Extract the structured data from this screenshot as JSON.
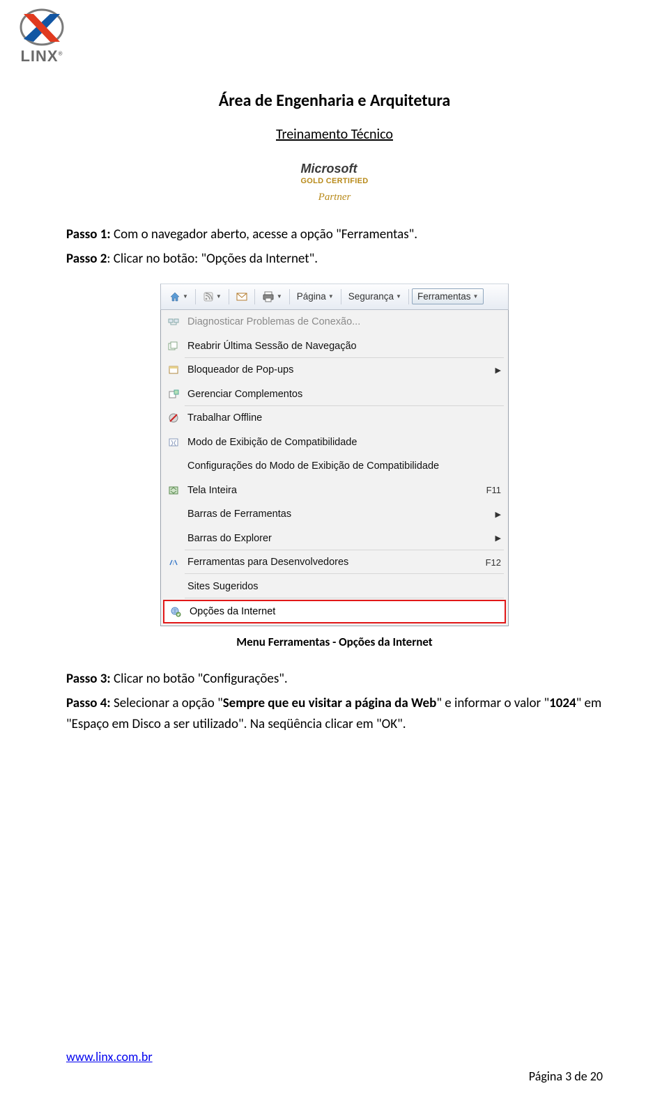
{
  "logo": {
    "text": "LINX",
    "reg": "®"
  },
  "header": {
    "title": "Área de Engenharia e Arquitetura",
    "subtitle": "Treinamento Técnico",
    "badge": {
      "line1": "Microsoft",
      "line2": "GOLD CERTIFIED",
      "line3": "Partner"
    }
  },
  "body": {
    "p1_label": "Passo 1:",
    "p1_text": " Com o navegador aberto, acesse a opção \"Ferramentas\".",
    "p2_label": "Passo 2",
    "p2_text": ": Clicar no botão: \"Opções da Internet\".",
    "caption": "Menu Ferramentas - Opções da Internet",
    "p3_label": "Passo 3:",
    "p3_text": " Clicar no botão \"Configurações\".",
    "p4_label": "Passo 4:",
    "p4_text_a": " Selecionar a opção \"",
    "p4_bold_a": "Sempre que eu visitar a página da Web",
    "p4_text_b": "\" e informar o valor \"",
    "p4_bold_b": "1024",
    "p4_text_c": "\" em \"Espaço em Disco a ser utilizado\". Na seqüência clicar em \"OK\"."
  },
  "screenshot": {
    "toolbar": {
      "pagina": "Página",
      "seguranca": "Segurança",
      "ferramentas": "Ferramentas"
    },
    "menu": [
      {
        "label": "Diagnosticar Problemas de Conexão...",
        "disabled": true
      },
      {
        "label": "Reabrir Última Sessão de Navegação",
        "sep_after": true
      },
      {
        "label": "Bloqueador de Pop-ups",
        "arrow": true
      },
      {
        "label": "Gerenciar Complementos",
        "sep_after": true
      },
      {
        "label": "Trabalhar Offline"
      },
      {
        "label": "Modo de Exibição de Compatibilidade"
      },
      {
        "label": "Configurações do Modo de Exibição de Compatibilidade"
      },
      {
        "label": "Tela Inteira",
        "shortcut": "F11"
      },
      {
        "label": "Barras de Ferramentas",
        "arrow": true
      },
      {
        "label": "Barras do Explorer",
        "arrow": true,
        "sep_after": true
      },
      {
        "label": "Ferramentas para Desenvolvedores",
        "shortcut": "F12",
        "sep_after": true
      },
      {
        "label": "Sites Sugeridos",
        "sep_after": true
      }
    ],
    "highlight": "Opções da Internet"
  },
  "footer": {
    "link": "www.linx.com.br",
    "page": "Página 3 de 20"
  }
}
